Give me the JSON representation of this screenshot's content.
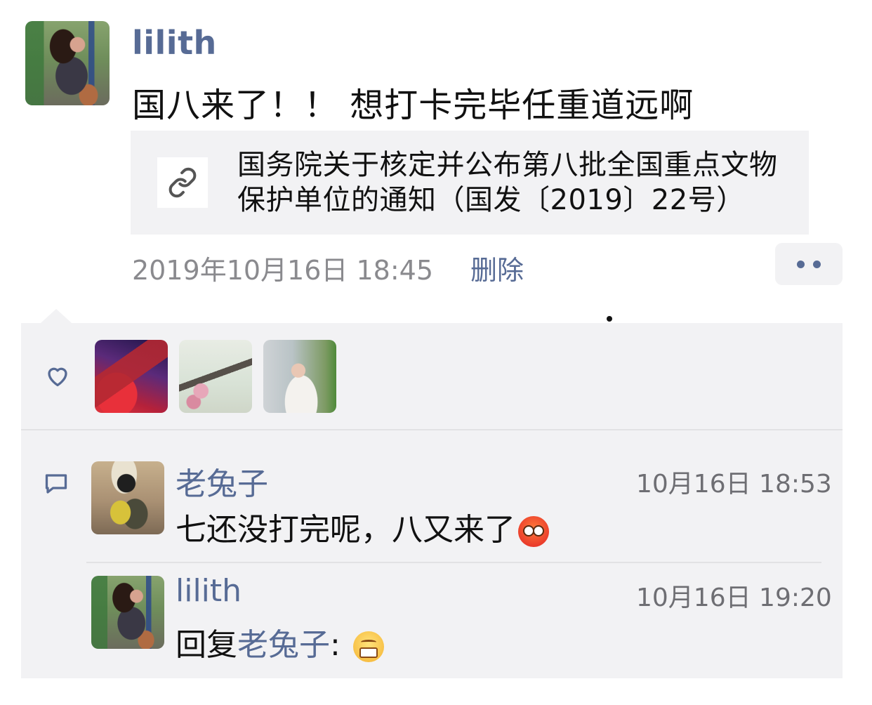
{
  "post": {
    "author": "lilith",
    "text": "国八来了！！ 想打卡完毕任重道远啊",
    "link_title": "国务院关于核定并公布第八批全国重点文物保护单位的通知（国发〔2019〕22号）",
    "time": "2019年10月16日 18:45",
    "delete_label": "删除",
    "more_icon": "more-dots-icon"
  },
  "likes": {
    "icon": "heart-outline-icon",
    "avatars": [
      "avatar-photo-stage",
      "avatar-painting-birds",
      "avatar-portrait-woman"
    ]
  },
  "comments": [
    {
      "author": "老兔子",
      "time": "10月16日 18:53",
      "text": "七还没打完呢，八又来了",
      "emoji": "pleading-face-emoji"
    },
    {
      "author": "lilith",
      "time": "10月16日 19:20",
      "reply_prefix": "回复",
      "reply_to": "老兔子",
      "separator": ":",
      "emoji": "grinning-face-emoji"
    }
  ],
  "colors": {
    "link_blue": "#576b95",
    "panel_bg": "#f2f2f4",
    "time_gray": "#8a8a8e"
  }
}
